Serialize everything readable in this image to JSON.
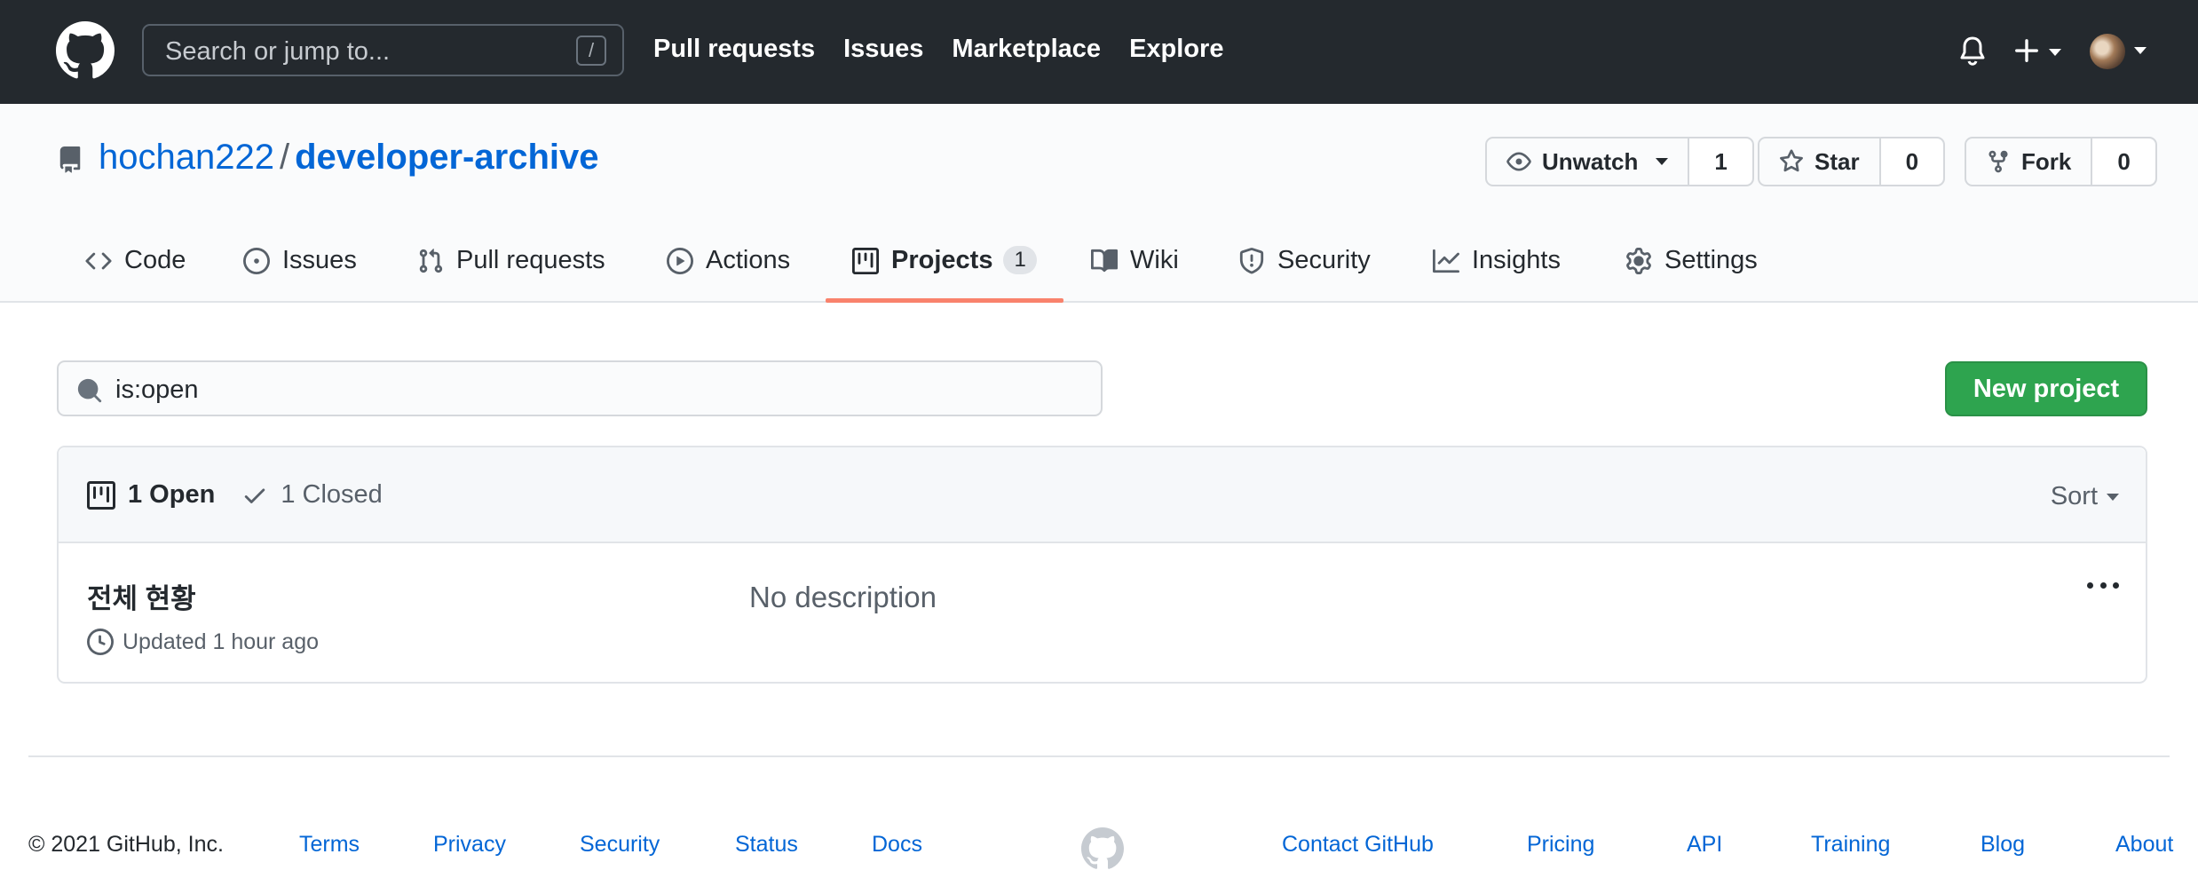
{
  "header": {
    "search_placeholder": "Search or jump to...",
    "search_shortcut": "/",
    "nav": [
      "Pull requests",
      "Issues",
      "Marketplace",
      "Explore"
    ]
  },
  "repo": {
    "owner": "hochan222",
    "separator": "/",
    "name": "developer-archive",
    "watch": {
      "label": "Unwatch",
      "count": "1"
    },
    "star": {
      "label": "Star",
      "count": "0"
    },
    "fork": {
      "label": "Fork",
      "count": "0"
    }
  },
  "tabs": [
    {
      "label": "Code",
      "icon": "code-icon"
    },
    {
      "label": "Issues",
      "icon": "issue-opened-icon"
    },
    {
      "label": "Pull requests",
      "icon": "git-pull-request-icon"
    },
    {
      "label": "Actions",
      "icon": "play-icon"
    },
    {
      "label": "Projects",
      "icon": "project-icon",
      "counter": "1",
      "selected": true
    },
    {
      "label": "Wiki",
      "icon": "book-icon"
    },
    {
      "label": "Security",
      "icon": "shield-icon"
    },
    {
      "label": "Insights",
      "icon": "graph-icon"
    },
    {
      "label": "Settings",
      "icon": "gear-icon"
    }
  ],
  "projects": {
    "filter_value": "is:open",
    "new_button": "New project",
    "open_label": "1 Open",
    "closed_label": "1 Closed",
    "sort_label": "Sort",
    "items": [
      {
        "title": "전체 현황",
        "updated": "Updated 1 hour ago",
        "description": "No description"
      }
    ]
  },
  "footer": {
    "copyright": "© 2021 GitHub, Inc.",
    "links_left": [
      "Terms",
      "Privacy",
      "Security",
      "Status",
      "Docs"
    ],
    "links_right": [
      "Contact GitHub",
      "Pricing",
      "API",
      "Training",
      "Blog",
      "About"
    ]
  },
  "colors": {
    "header_bg": "#24292e",
    "link": "#0366d6",
    "primary_button": "#2ea44f",
    "selected_tab_underline": "#f9826c"
  }
}
